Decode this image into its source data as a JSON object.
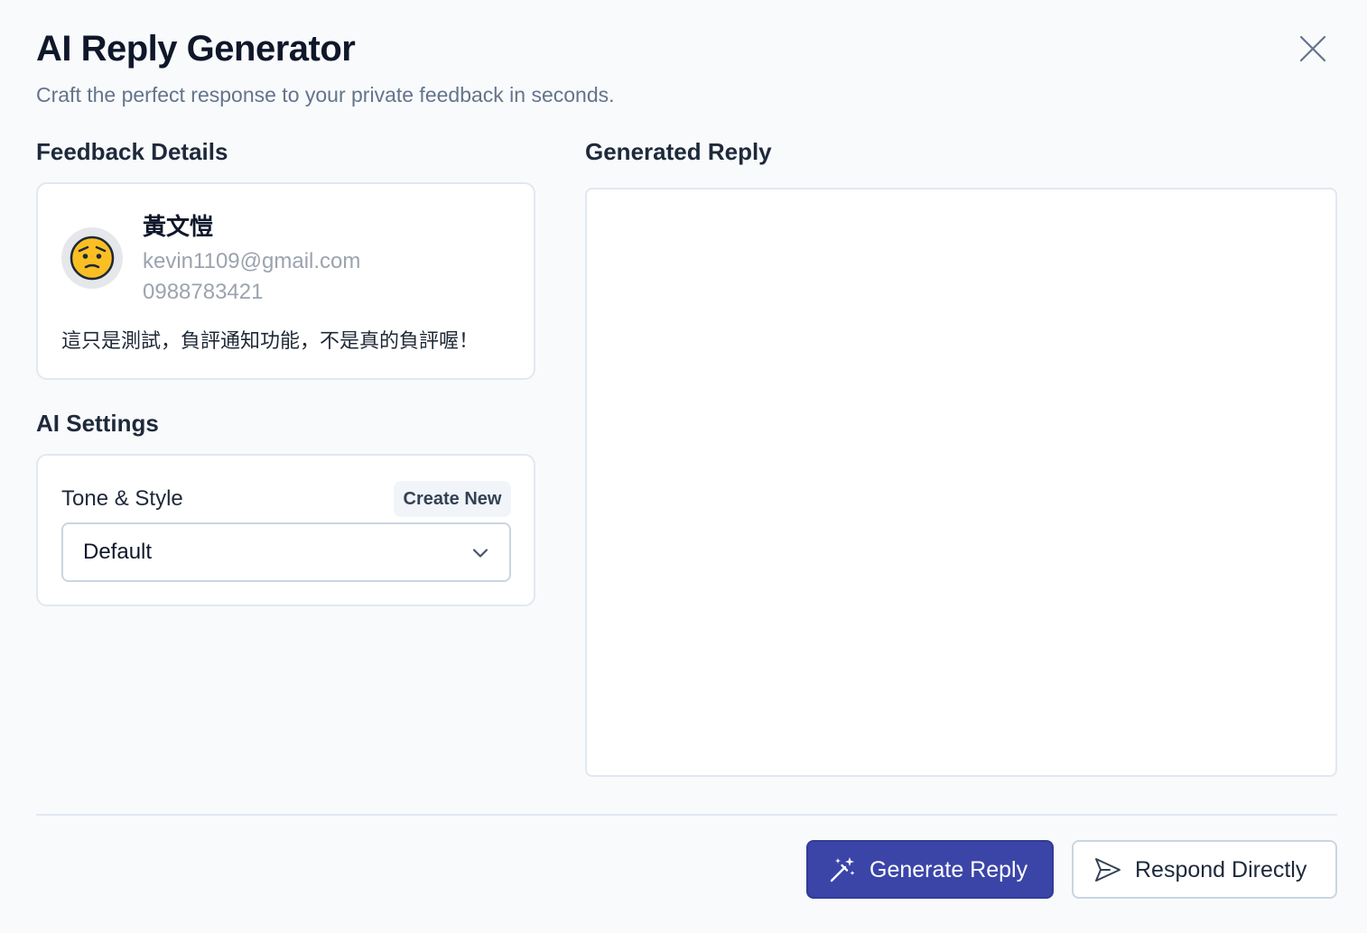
{
  "header": {
    "title": "AI Reply Generator",
    "subtitle": "Craft the perfect response to your private feedback in seconds."
  },
  "feedback": {
    "heading": "Feedback Details",
    "user": {
      "name": "黃文愷",
      "email": "kevin1109@gmail.com",
      "phone": "0988783421",
      "avatar_icon": "worried-face-icon"
    },
    "message": "這只是測試，負評通知功能，不是真的負評喔！"
  },
  "settings": {
    "heading": "AI Settings",
    "tone_label": "Tone & Style",
    "create_new_label": "Create New",
    "selected_tone": "Default"
  },
  "reply": {
    "heading": "Generated Reply",
    "value": ""
  },
  "actions": {
    "generate_label": "Generate Reply",
    "respond_label": "Respond Directly"
  },
  "colors": {
    "primary": "#3b45a8",
    "background": "#f8fafc",
    "border": "#e2e8f0",
    "muted_text": "#64748b"
  }
}
